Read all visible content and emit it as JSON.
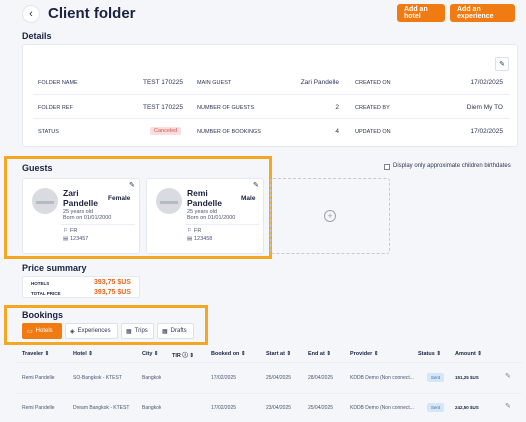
{
  "header": {
    "back_icon": "chevron-left-icon",
    "title": "Client folder",
    "add_hotel": "Add an hotel",
    "add_experience": "Add an experience"
  },
  "details": {
    "title": "Details",
    "edit_icon": "pencil-icon",
    "folder_name_label": "FOLDER NAME",
    "folder_name": "TEST 170225",
    "main_guest_label": "MAIN GUEST",
    "main_guest": "Zari Pandelle",
    "created_on_label": "CREATED ON",
    "created_on": "17/02/2025",
    "folder_ref_label": "FOLDER REF",
    "folder_ref": "TEST 170225",
    "num_guests_label": "NUMBER OF GUESTS",
    "num_guests": "2",
    "created_by_label": "CREATED BY",
    "created_by": "Diem My TO",
    "status_label": "STATUS",
    "status": "Canceled",
    "num_bookings_label": "NUMBER OF BOOKINGS",
    "num_bookings": "4",
    "updated_on_label": "UPDATED ON",
    "updated_on": "17/02/2025"
  },
  "guests": {
    "title": "Guests",
    "approx_children_label": "Display only approximate children birthdates",
    "items": [
      {
        "first": "Zari",
        "last": "Pandelle",
        "gender": "Female",
        "age": "25 years old",
        "born": "Born on 01/01/2000",
        "country": "FR",
        "id": "123457"
      },
      {
        "first": "Remi",
        "last": "Pandelle",
        "gender": "Male",
        "age": "25 years old",
        "born": "Born on 01/01/2000",
        "country": "FR",
        "id": "123458"
      }
    ]
  },
  "price": {
    "title": "Price summary",
    "hotels_label": "HOTELS",
    "hotels_value": "393,75 $US",
    "total_label": "TOTAL PRICE",
    "total_value": "393,75 $US"
  },
  "bookings": {
    "title": "Bookings",
    "tabs": [
      "Hotels",
      "Experiences",
      "Trips",
      "Drafts"
    ],
    "columns": [
      "Traveler ⇕",
      "Hotel ⇕",
      "City ⇕",
      "TIR ⓘ ⇕",
      "Booked on ⇕",
      "Start at ⇕",
      "End at ⇕",
      "Provider ⇕",
      "Status ⇕",
      "Amount ⇕"
    ],
    "rows": [
      {
        "traveler": "Remi Pandelle",
        "hotel": "SO-Bangkok - KTEST",
        "city": "Bangkok",
        "booked": "17/02/2025",
        "start": "25/04/2025",
        "end": "28/04/2025",
        "provider": "KDDB Demo (Non connect...",
        "status": "Sent",
        "amount": "151,25 $US"
      },
      {
        "traveler": "Remi Pandelle",
        "hotel": "Dream Bangkok - KTEST",
        "city": "Bangkok",
        "booked": "17/02/2025",
        "start": "23/04/2025",
        "end": "25/04/2025",
        "provider": "KDDB Demo (Non connect...",
        "status": "Sent",
        "amount": "242,50 $US"
      }
    ]
  },
  "colors": {
    "accent": "#f07b12",
    "highlight": "#f5a623",
    "canceled_bg": "#fcdede",
    "price": "#e8661c"
  }
}
